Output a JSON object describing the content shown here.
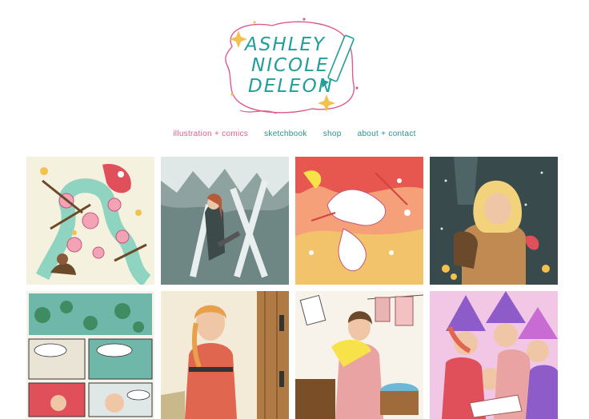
{
  "site": {
    "logo_lines": [
      "ASHLEY",
      "NICOLE",
      "DELEON"
    ],
    "accent_color": "#e05a8e",
    "brand_color": "#1f9e9a"
  },
  "nav": {
    "items": [
      {
        "label": "illustration + comics",
        "active": true
      },
      {
        "label": "sketchbook",
        "active": false
      },
      {
        "label": "shop",
        "active": false
      },
      {
        "label": "about + contact",
        "active": false
      }
    ]
  },
  "gallery": {
    "tiles": [
      {
        "subject": "flowers-and-dragon-illustration"
      },
      {
        "subject": "cave-explorer-illustration"
      },
      {
        "subject": "fire-battle-illustration"
      },
      {
        "subject": "forest-traveler-illustration"
      },
      {
        "subject": "comic-page-illustration"
      },
      {
        "subject": "woman-at-door-illustration"
      },
      {
        "subject": "laundry-witch-illustration"
      },
      {
        "subject": "witches-reading-illustration"
      }
    ]
  }
}
